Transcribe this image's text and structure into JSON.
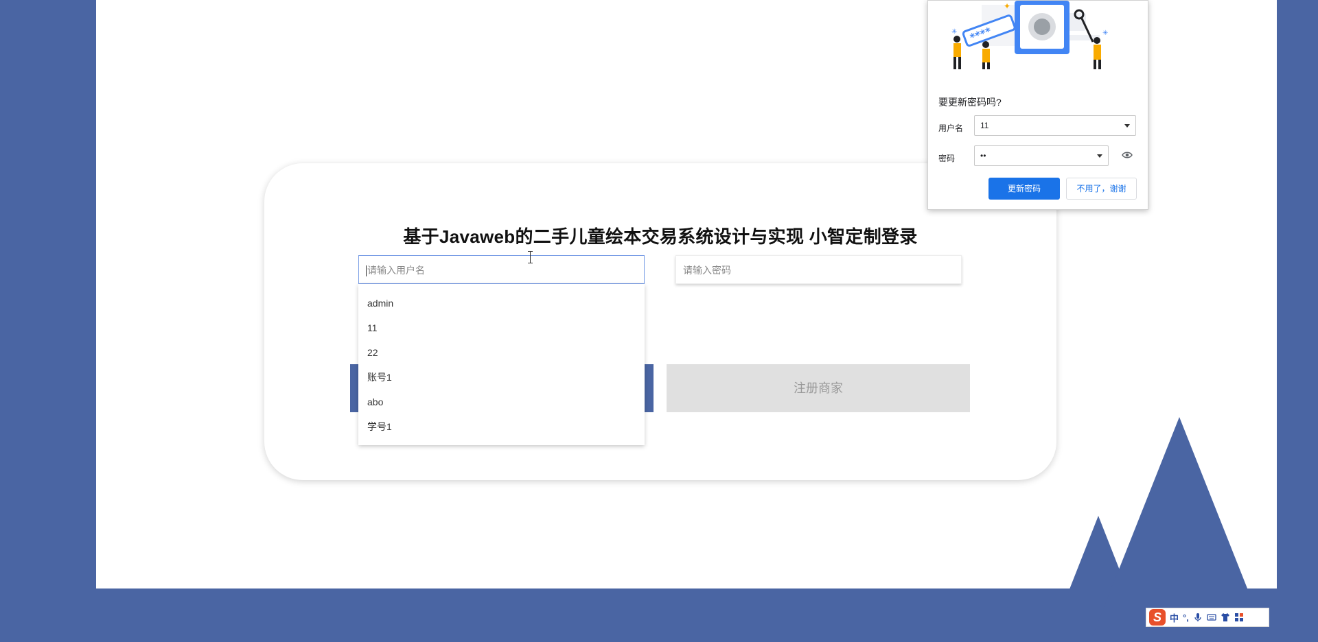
{
  "login": {
    "title": "基于Javaweb的二手儿童绘本交易系统设计与实现 小智定制登录",
    "username_placeholder": "请输入用户名",
    "password_placeholder": "请输入密码",
    "register_label": "注册商家"
  },
  "autocomplete": {
    "items": [
      "admin",
      "11",
      "22",
      "账号1",
      "abo",
      "学号1"
    ]
  },
  "password_popup": {
    "question": "要更新密码吗?",
    "username_label": "用户名",
    "username_value": "11",
    "password_label": "密码",
    "password_value": "••",
    "update_button": "更新密码",
    "decline_button": "不用了，谢谢",
    "illustration_stars": "****"
  },
  "ime": {
    "logo": "S",
    "mode_text": "中",
    "punct_text": "°,",
    "icons": [
      "microphone-icon",
      "keyboard-icon",
      "tshirt-icon",
      "grid-icon"
    ]
  },
  "colors": {
    "brand_blue": "#4a65a3",
    "chrome_blue": "#1a73e8",
    "register_gray": "#e0e0e0"
  }
}
